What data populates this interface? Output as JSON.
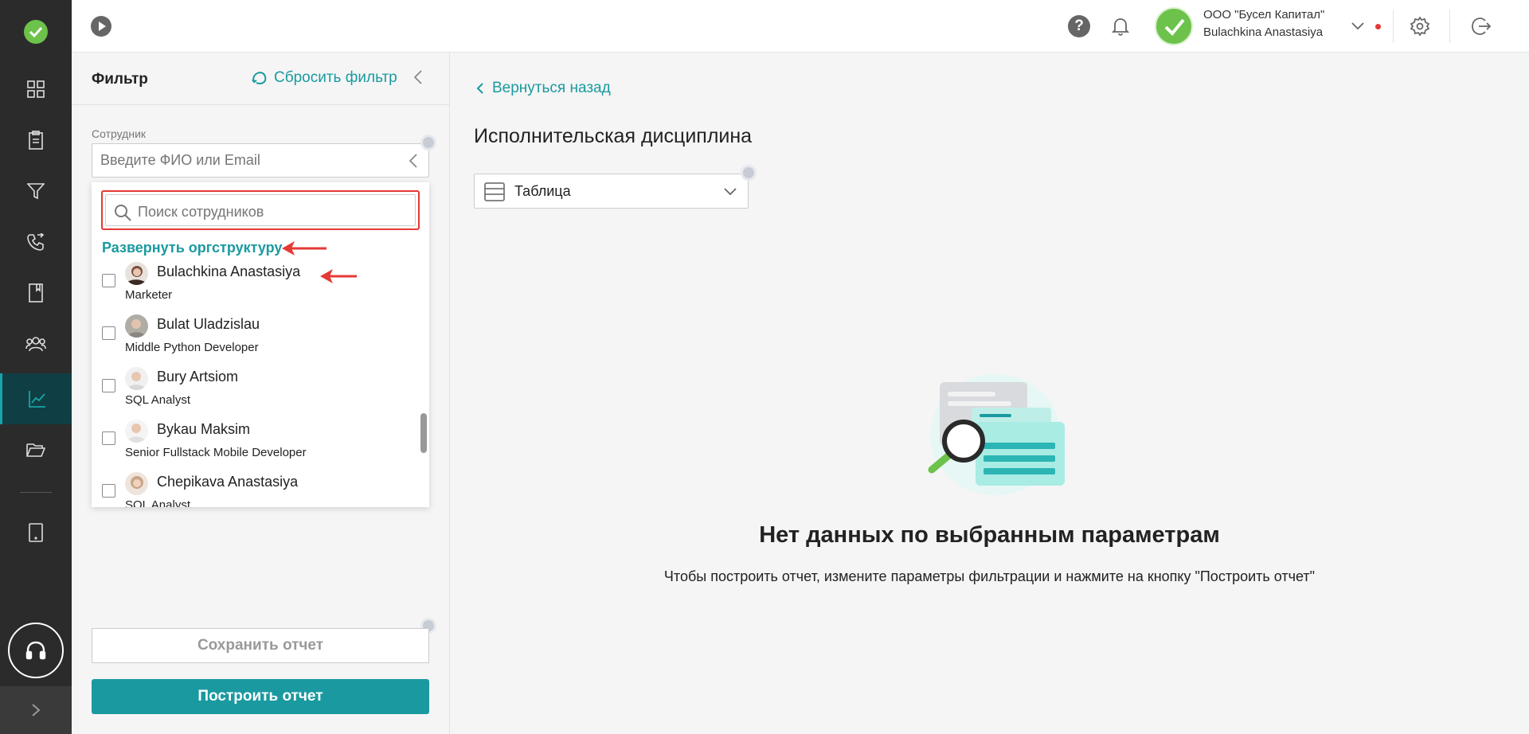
{
  "header": {
    "company_name": "ООО \"Бусел Капитал\"",
    "user_name": "Bulachkina Anastasiya"
  },
  "filter": {
    "title": "Фильтр",
    "reset_label": "Сбросить фильтр",
    "employee_label": "Сотрудник",
    "employee_placeholder": "Введите ФИО или Email",
    "search_placeholder": "Поиск сотрудников",
    "expand_orgstructure": "Развернуть оргструктуру",
    "employees": [
      {
        "name": "Bulachkina Anastasiya",
        "position": "Marketer"
      },
      {
        "name": "Bulat Uladzislau",
        "position": "Middle Python Developer"
      },
      {
        "name": "Bury Artsiom",
        "position": "SQL Analyst"
      },
      {
        "name": "Bykau Maksim",
        "position": "Senior Fullstack Mobile Developer"
      },
      {
        "name": "Chepikava Anastasiya",
        "position": "SQL Analyst"
      }
    ],
    "save_label": "Сохранить отчет",
    "build_label": "Построить отчет"
  },
  "main": {
    "back_label": "Вернуться назад",
    "title": "Исполнительская дисциплина",
    "view_select": "Таблица",
    "empty_title": "Нет данных по выбранным параметрам",
    "empty_text": "Чтобы построить отчет, измените параметры фильтрации и нажмите на кнопку \"Построить отчет\""
  },
  "colors": {
    "accent": "#1a9aa0",
    "nav_bg": "#2b2b2b",
    "highlight": "#e53935"
  }
}
